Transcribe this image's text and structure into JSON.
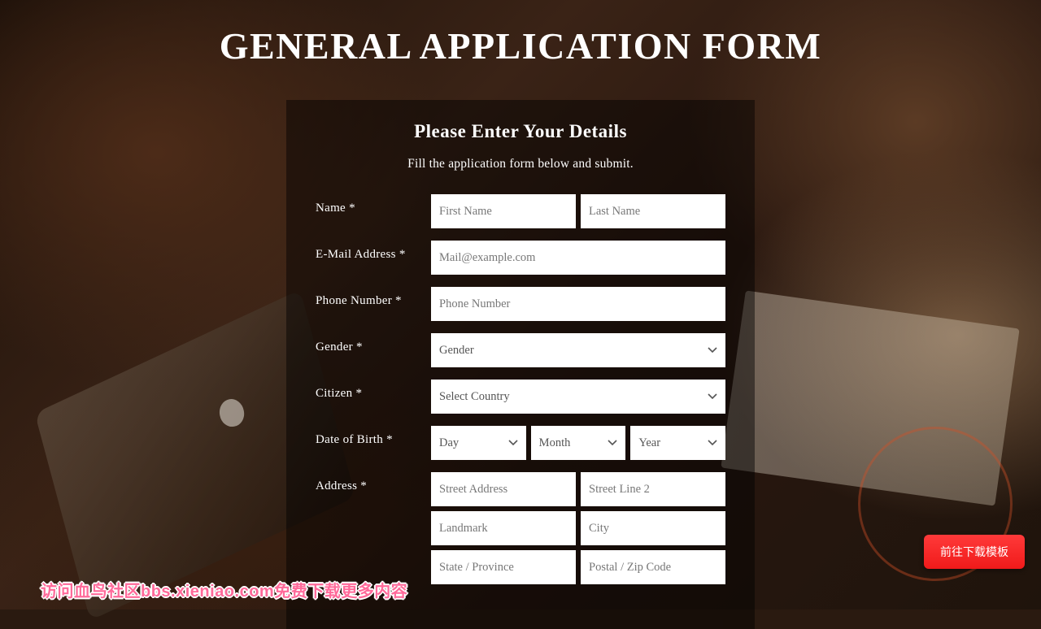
{
  "title": "GENERAL APPLICATION FORM",
  "subtitle": "Please Enter Your Details",
  "instruction": "Fill the application form below and submit.",
  "labels": {
    "name": "Name *",
    "email": "E-Mail Address *",
    "phone": "Phone Number *",
    "gender": "Gender *",
    "citizen": "Citizen *",
    "dob": "Date of Birth *",
    "address": "Address *"
  },
  "placeholders": {
    "first_name": "First Name",
    "last_name": "Last Name",
    "email": "Mail@example.com",
    "phone": "Phone Number",
    "street": "Street Address",
    "street2": "Street Line 2",
    "landmark": "Landmark",
    "city": "City",
    "state": "State / Province",
    "postal": "Postal / Zip Code"
  },
  "selects": {
    "gender": "Gender",
    "country": "Select Country",
    "day": "Day",
    "month": "Month",
    "year": "Year"
  },
  "download_button": "前往下载模板",
  "watermark": "访问血鸟社区bbs.xieniao.com免费下载更多内容"
}
